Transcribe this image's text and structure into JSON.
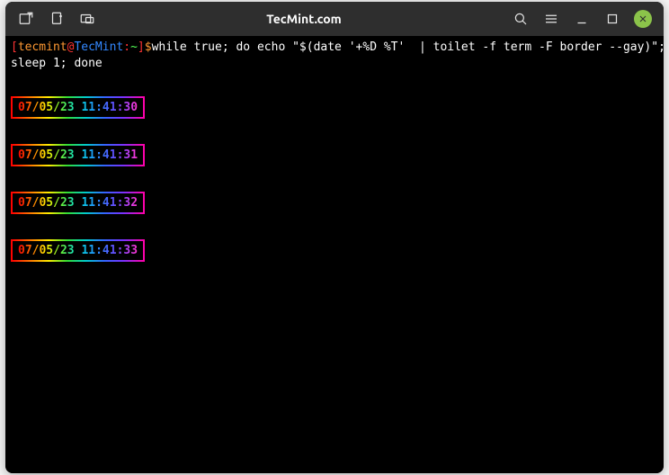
{
  "titlebar": {
    "title": "TecMint.com"
  },
  "prompt": {
    "open": "[",
    "user": "tecmint",
    "at": "@",
    "host": "TecMint",
    "sep": ":",
    "path": "~",
    "close": "]",
    "dollar": "$",
    "command_line1": "while true; do echo \"$(date '+%D %T'  | toilet -f term -F border --gay)\";",
    "command_line2": "sleep 1; done"
  },
  "clocks": [
    "07/05/23 11:41:30",
    "07/05/23 11:41:31",
    "07/05/23 11:41:32",
    "07/05/23 11:41:33"
  ]
}
